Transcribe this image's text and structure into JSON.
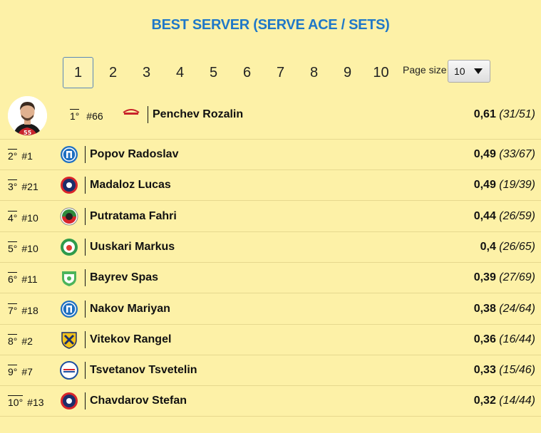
{
  "title": "BEST SERVER (SERVE ACE / SETS)",
  "pagination": {
    "pages": [
      "1",
      "2",
      "3",
      "4",
      "5",
      "6",
      "7",
      "8",
      "9",
      "10"
    ],
    "active": "1",
    "page_size_label": "Page size",
    "page_size_value": "10"
  },
  "leader": {
    "rank": "1°",
    "number": "#66",
    "name": "Penchev Rozalin",
    "ratio": "0,61",
    "detail": "(31/51)",
    "logo": "team-logo-red",
    "avatar_number": "55"
  },
  "players": [
    {
      "rank": "2°",
      "number": "#1",
      "name": "Popov Radoslav",
      "ratio": "0,49",
      "detail": "(33/67)",
      "logo": "team-logo-blue-p",
      "logo_color": "#1e6fc0"
    },
    {
      "rank": "3°",
      "number": "#21",
      "name": "Madaloz Lucas",
      "ratio": "0,49",
      "detail": "(19/39)",
      "logo": "team-logo-navy-red",
      "logo_color": "#1b2e6b"
    },
    {
      "rank": "4°",
      "number": "#10",
      "name": "Putratama Fahri",
      "ratio": "0,44",
      "detail": "(26/59)",
      "logo": "team-logo-tricolor",
      "logo_color": "#2f8a3c"
    },
    {
      "rank": "5°",
      "number": "#10",
      "name": "Uuskari Markus",
      "ratio": "0,4",
      "detail": "(26/65)",
      "logo": "team-logo-green",
      "logo_color": "#2f9b4b"
    },
    {
      "rank": "6°",
      "number": "#11",
      "name": "Bayrev Spas",
      "ratio": "0,39",
      "detail": "(27/69)",
      "logo": "team-logo-green-shield",
      "logo_color": "#4cb45a"
    },
    {
      "rank": "7°",
      "number": "#18",
      "name": "Nakov Mariyan",
      "ratio": "0,38",
      "detail": "(24/64)",
      "logo": "team-logo-blue-p",
      "logo_color": "#1e6fc0"
    },
    {
      "rank": "8°",
      "number": "#2",
      "name": "Vitekov Rangel",
      "ratio": "0,36",
      "detail": "(16/44)",
      "logo": "team-logo-yellow-shield",
      "logo_color": "#f2c21a"
    },
    {
      "rank": "9°",
      "number": "#7",
      "name": "Tsvetanov Tsvetelin",
      "ratio": "0,33",
      "detail": "(15/46)",
      "logo": "team-logo-blue-red",
      "logo_color": "#d8252b"
    },
    {
      "rank": "10°",
      "number": "#13",
      "name": "Chavdarov Stefan",
      "ratio": "0,32",
      "detail": "(14/44)",
      "logo": "team-logo-navy-red",
      "logo_color": "#1b2e6b"
    }
  ]
}
